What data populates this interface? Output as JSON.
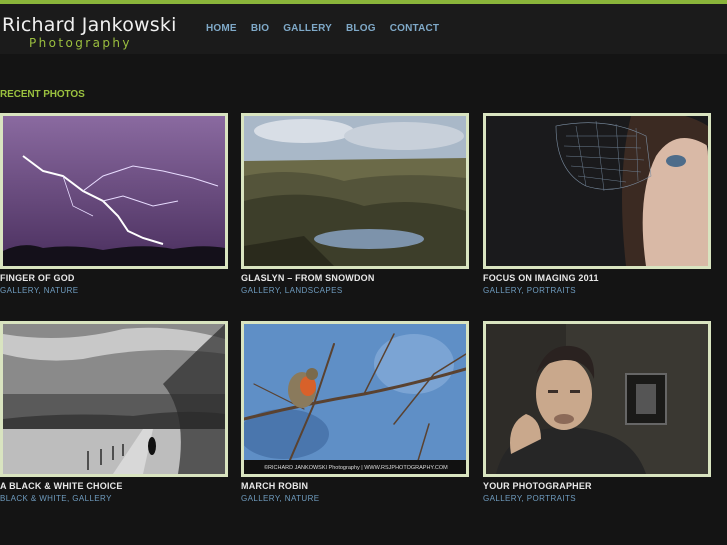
{
  "site": {
    "name": "Richard Jankowski",
    "tagline": "Photography"
  },
  "nav": [
    "HOME",
    "BIO",
    "GALLERY",
    "BLOG",
    "CONTACT"
  ],
  "section_title": "RECENT PHOTOS",
  "posts": [
    {
      "title": "FINGER OF GOD",
      "cats": [
        "GALLERY",
        "NATURE"
      ],
      "caption": ""
    },
    {
      "title": "GLASLYN – FROM SNOWDON",
      "cats": [
        "GALLERY",
        "LANDSCAPES"
      ],
      "caption": ""
    },
    {
      "title": "FOCUS ON IMAGING 2011",
      "cats": [
        "GALLERY",
        "PORTRAITS"
      ],
      "caption": ""
    },
    {
      "title": "A BLACK & WHITE CHOICE",
      "cats": [
        "BLACK & WHITE",
        "GALLERY"
      ],
      "caption": ""
    },
    {
      "title": "MARCH ROBIN",
      "cats": [
        "GALLERY",
        "NATURE"
      ],
      "caption": "©RICHARD JANKOWSKI Photography | WWW.RSJPHOTOGRAPHY.COM"
    },
    {
      "title": "YOUR PHOTOGRAPHER",
      "cats": [
        "GALLERY",
        "PORTRAITS"
      ],
      "caption": ""
    }
  ],
  "colors": {
    "accent": "#8ab43a",
    "link": "#7fa9c8",
    "frame": "#d9e4c0"
  }
}
